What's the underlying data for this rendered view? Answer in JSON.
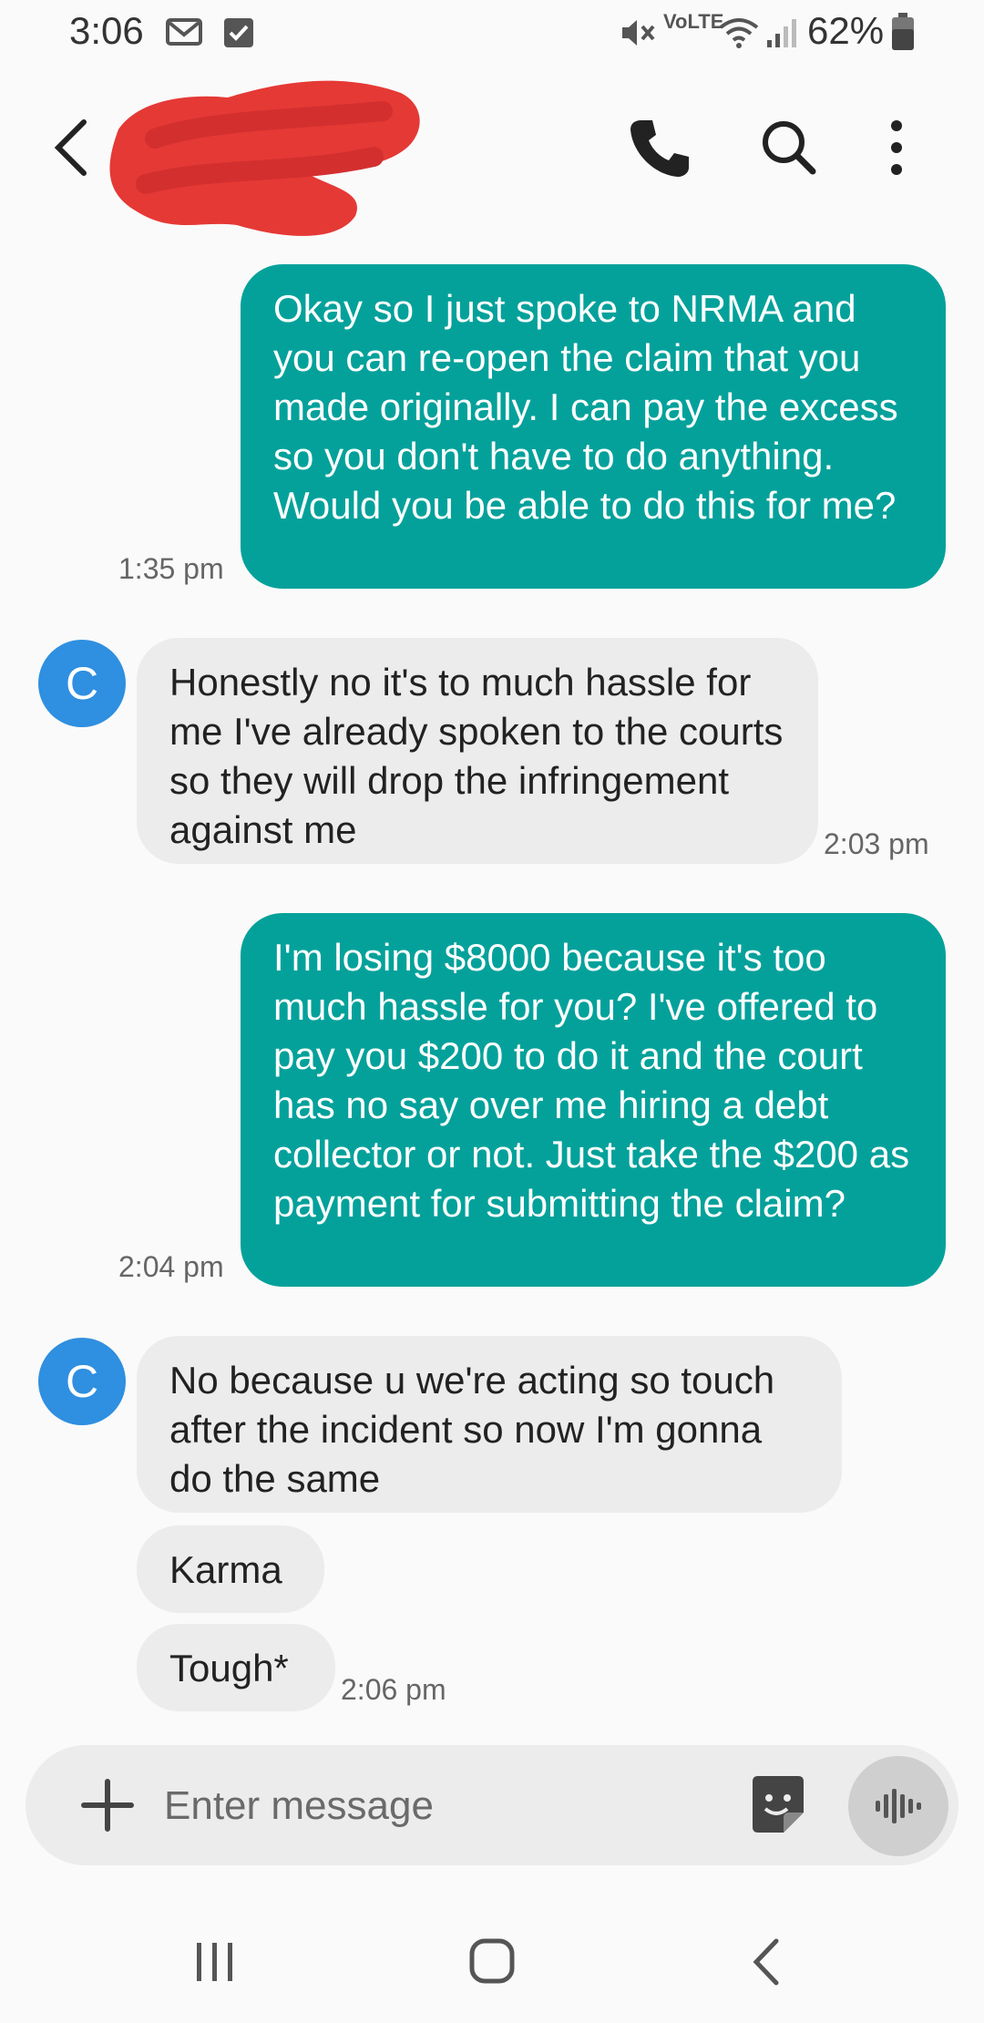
{
  "status_bar": {
    "time": "3:06",
    "battery": "62%",
    "network_label": "VoLTE"
  },
  "header": {
    "contact_name_redacted": true
  },
  "messages": [
    {
      "direction": "sent",
      "text": "Okay so I just spoke to NRMA and you can re-open the claim that you made originally. I can pay the excess so you don't have to do anything. Would you be able to do this for me?",
      "time": "1:35 pm"
    },
    {
      "direction": "received",
      "avatar": "C",
      "text": "Honestly no it's to much hassle for me I've already spoken to the courts so they will drop the infringement against me",
      "time": "2:03 pm"
    },
    {
      "direction": "sent",
      "text": "I'm losing $8000 because it's too much hassle for you? I've offered to pay you $200 to do it and the court has no say over me hiring a debt collector or not. Just take the $200 as payment for submitting the claim?",
      "time": "2:04 pm"
    },
    {
      "direction": "received",
      "avatar": "C",
      "text": "No because u we're acting so touch after the incident so now I'm gonna do the same"
    },
    {
      "direction": "received",
      "text": "Karma"
    },
    {
      "direction": "received",
      "text": "Tough*",
      "time": "2:06 pm"
    }
  ],
  "composer": {
    "placeholder": "Enter message"
  },
  "colors": {
    "sent_bubble": "#04a19b",
    "received_bubble": "#ececec",
    "avatar": "#2f8fe0",
    "redaction": "#e53935"
  }
}
